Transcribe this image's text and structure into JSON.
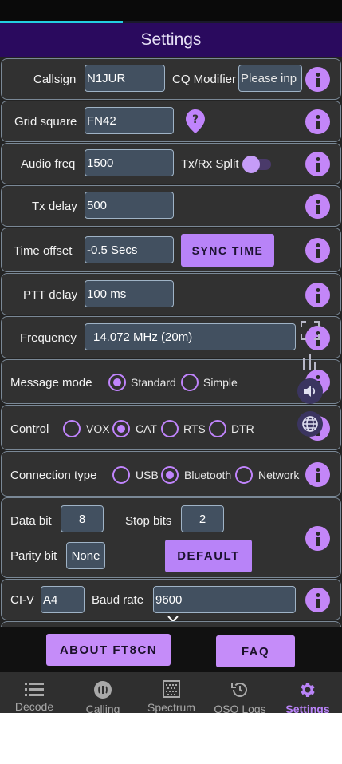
{
  "header": {
    "title": "Settings",
    "progress": 0.36
  },
  "colors": {
    "accent": "#c084fc",
    "title_bar": "#2a0a5e",
    "field_bg": "#425060",
    "row_bg": "#313131",
    "progress": "#23d0e0"
  },
  "rows": {
    "callsign": {
      "label": "Callsign",
      "value": "N1JUR",
      "cq_label": "CQ Modifier",
      "cq_placeholder": "Please inp"
    },
    "grid": {
      "label": "Grid square",
      "value": "FN42"
    },
    "audio": {
      "label": "Audio freq",
      "value": "1500",
      "split_label": "Tx/Rx Split",
      "split_on": true
    },
    "txdelay": {
      "label": "Tx delay",
      "value": "500"
    },
    "timeoffset": {
      "label": "Time offset",
      "value": "-0.5 Secs",
      "sync_label": "SYNC TIME"
    },
    "ptt": {
      "label": "PTT delay",
      "value": "100 ms"
    },
    "frequency": {
      "label": "Frequency",
      "value": "14.072 MHz (20m)"
    },
    "message": {
      "label": "Message mode",
      "options": [
        "Standard",
        "Simple"
      ],
      "selected": "Standard"
    },
    "control": {
      "label": "Control",
      "options": [
        "VOX",
        "CAT",
        "RTS",
        "DTR"
      ],
      "selected": "CAT"
    },
    "connection": {
      "label": "Connection type",
      "options": [
        "USB",
        "Bluetooth",
        "Network"
      ],
      "selected": "Bluetooth"
    },
    "serial": {
      "data_label": "Data bit",
      "data_value": "8",
      "stop_label": "Stop bits",
      "stop_value": "2",
      "parity_label": "Parity bit",
      "parity_value": "None",
      "default_label": "DEFAULT"
    },
    "civ": {
      "label": "CI-V",
      "value": "A4",
      "baud_label": "Baud rate",
      "baud_value": "9600"
    }
  },
  "bottom_buttons": {
    "about": "ABOUT FT8CN",
    "faq": "FAQ"
  },
  "nav": [
    {
      "label": "Decode",
      "icon": "list-icon"
    },
    {
      "label": "Calling",
      "icon": "calling-icon"
    },
    {
      "label": "Spectrum",
      "icon": "spectrum-icon"
    },
    {
      "label": "QSO Logs",
      "icon": "history-icon"
    },
    {
      "label": "Settings",
      "icon": "gear-icon",
      "active": true
    }
  ],
  "floating_icons": [
    "fullscreen-icon",
    "bar-chart-icon",
    "volume-icon",
    "globe-icon"
  ]
}
